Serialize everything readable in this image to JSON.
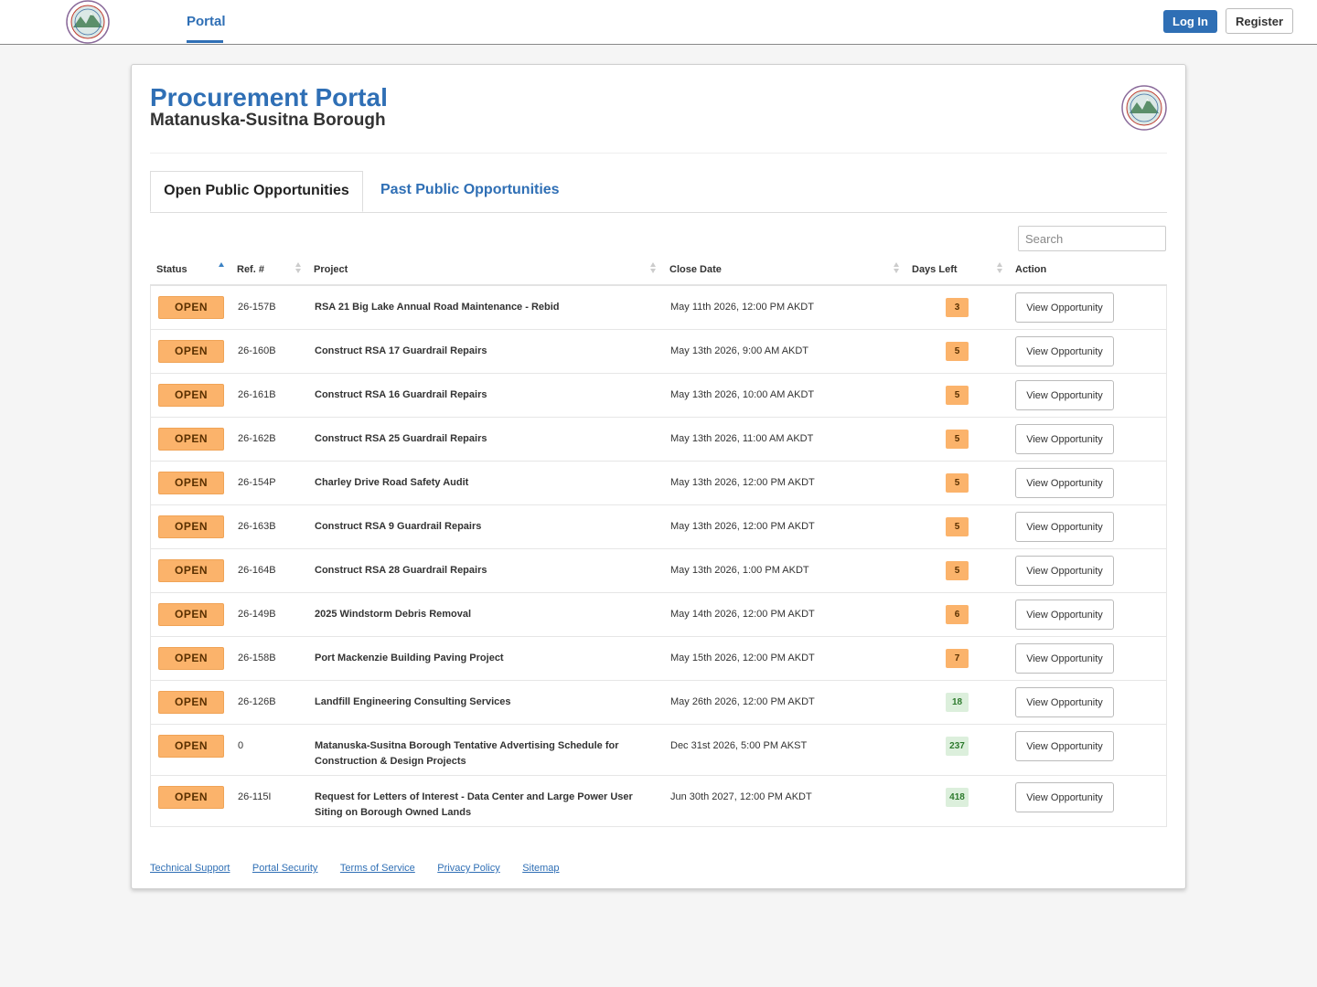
{
  "nav": {
    "tab_label": "Portal",
    "login_label": "Log In",
    "register_label": "Register"
  },
  "header": {
    "title": "Procurement Portal",
    "subtitle": "Matanuska-Susitna Borough"
  },
  "tabs": [
    {
      "label": "Open Public Opportunities",
      "active": true
    },
    {
      "label": "Past Public Opportunities",
      "active": false
    }
  ],
  "search": {
    "placeholder": "Search",
    "value": ""
  },
  "table": {
    "columns": [
      "Status",
      "Ref. #",
      "Project",
      "Close Date",
      "Days Left",
      "Action"
    ],
    "rows": [
      {
        "status": "OPEN",
        "ref": "26-157B",
        "project": "RSA 21 Big Lake Annual Road Maintenance - Rebid",
        "close": "May 11th 2026, 12:00 PM AKDT",
        "days": "3",
        "action": "View Opportunity"
      },
      {
        "status": "OPEN",
        "ref": "26-160B",
        "project": "Construct RSA 17 Guardrail Repairs",
        "close": "May 13th 2026, 9:00 AM AKDT",
        "days": "5",
        "action": "View Opportunity"
      },
      {
        "status": "OPEN",
        "ref": "26-161B",
        "project": "Construct RSA 16 Guardrail Repairs",
        "close": "May 13th 2026, 10:00 AM AKDT",
        "days": "5",
        "action": "View Opportunity"
      },
      {
        "status": "OPEN",
        "ref": "26-162B",
        "project": "Construct RSA 25 Guardrail Repairs",
        "close": "May 13th 2026, 11:00 AM AKDT",
        "days": "5",
        "action": "View Opportunity"
      },
      {
        "status": "OPEN",
        "ref": "26-154P",
        "project": "Charley Drive Road Safety Audit",
        "close": "May 13th 2026, 12:00 PM AKDT",
        "days": "5",
        "action": "View Opportunity"
      },
      {
        "status": "OPEN",
        "ref": "26-163B",
        "project": "Construct RSA 9 Guardrail Repairs",
        "close": "May 13th 2026, 12:00 PM AKDT",
        "days": "5",
        "action": "View Opportunity"
      },
      {
        "status": "OPEN",
        "ref": "26-164B",
        "project": "Construct RSA 28 Guardrail Repairs",
        "close": "May 13th 2026, 1:00 PM AKDT",
        "days": "5",
        "action": "View Opportunity"
      },
      {
        "status": "OPEN",
        "ref": "26-149B",
        "project": "2025 Windstorm Debris Removal",
        "close": "May 14th 2026, 12:00 PM AKDT",
        "days": "6",
        "action": "View Opportunity"
      },
      {
        "status": "OPEN",
        "ref": "26-158B",
        "project": "Port Mackenzie Building Paving Project",
        "close": "May 15th 2026, 12:00 PM AKDT",
        "days": "7",
        "action": "View Opportunity"
      },
      {
        "status": "OPEN",
        "ref": "26-126B",
        "project": "Landfill Engineering Consulting Services",
        "close": "May 26th 2026, 12:00 PM AKDT",
        "days": "18",
        "action": "View Opportunity"
      },
      {
        "status": "OPEN",
        "ref": "0",
        "project": "Matanuska-Susitna Borough Tentative Advertising Schedule for Construction & Design Projects",
        "close": "Dec 31st 2026, 5:00 PM AKST",
        "days": "237",
        "action": "View Opportunity"
      },
      {
        "status": "OPEN",
        "ref": "26-115I",
        "project": "Request for Letters of Interest - Data Center and Large Power User Siting on Borough Owned Lands",
        "close": "Jun 30th 2027, 12:00 PM AKDT",
        "days": "418",
        "action": "View Opportunity"
      }
    ]
  },
  "footer": {
    "links": [
      "Technical Support",
      "Portal Security",
      "Terms of Service",
      "Privacy Policy",
      "Sitemap"
    ]
  },
  "colors": {
    "accent": "#2f6fb5",
    "status_badge": "#fbb36b",
    "days_warning": "#fbb36b",
    "days_ok": "#dcefdc"
  },
  "icons": {
    "logo": "borough-seal-icon",
    "sort_asc": "sort-ascending-icon",
    "sort": "sort-icon"
  }
}
